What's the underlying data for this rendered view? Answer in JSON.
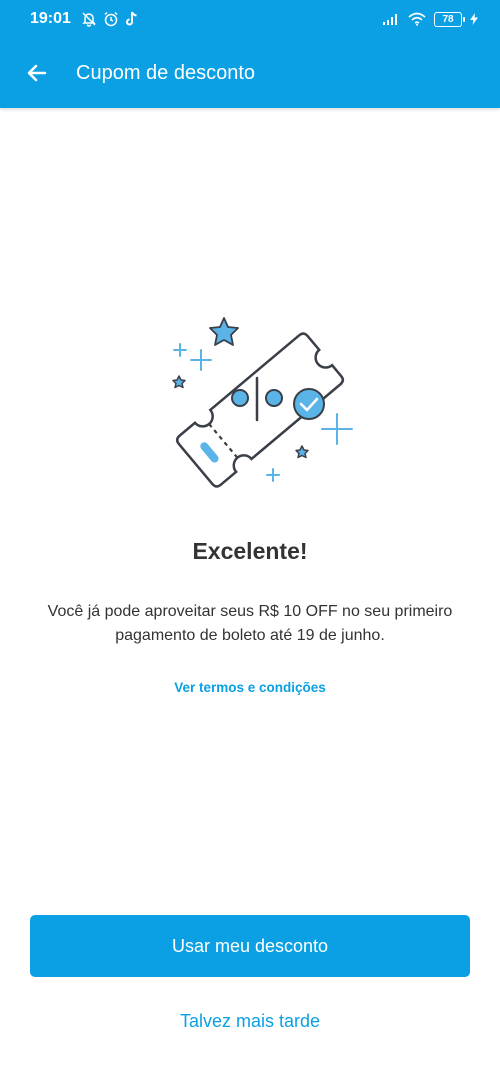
{
  "status_bar": {
    "time": "19:01",
    "battery": "78",
    "icons": [
      "bell-off-icon",
      "alarm-icon",
      "tiktok-icon",
      "signal-icon",
      "wifi-icon",
      "charging-icon"
    ]
  },
  "app_bar": {
    "title": "Cupom de desconto",
    "back_icon": "arrow-left-icon"
  },
  "content": {
    "illustration": "coupon-ticket-illustration",
    "headline": "Excelente!",
    "description": "Você já pode aproveitar seus R$ 10 OFF no seu primeiro pagamento de boleto até 19 de junho.",
    "terms_link": "Ver termos e condições"
  },
  "actions": {
    "primary": "Usar meu desconto",
    "secondary": "Talvez mais tarde"
  },
  "colors": {
    "brand": "#0ba0e3",
    "illustration_fill": "#5ab4e8",
    "outline": "#3a3f48"
  }
}
